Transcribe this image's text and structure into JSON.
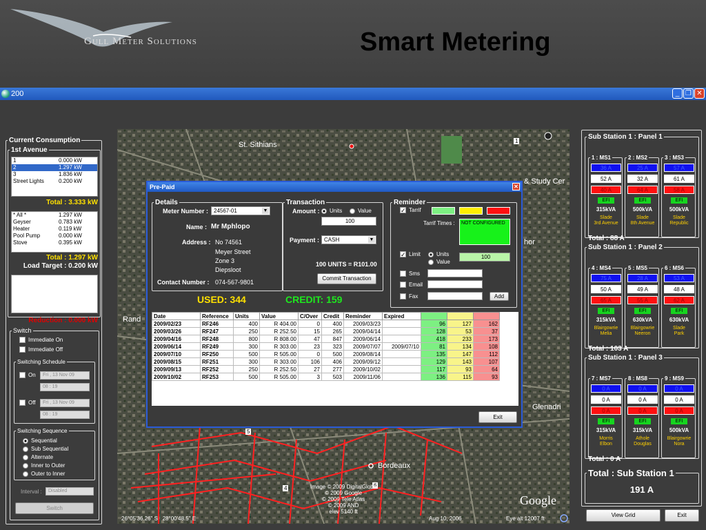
{
  "header": {
    "company": "Gull Meter Solutions",
    "slide_title": "Smart Metering"
  },
  "window": {
    "title": "200",
    "min": "_",
    "max": "❐",
    "close": "✕"
  },
  "left": {
    "current_consumption": "Current Consumption",
    "avenue": "1st Avenue",
    "avenue_rows": [
      {
        "n": "1",
        "v": "0.000 kW"
      },
      {
        "n": "2",
        "v": "1.297 kW"
      },
      {
        "n": "3",
        "v": "1.836 kW"
      },
      {
        "n": "Street Lights",
        "v": "0.200 kW"
      }
    ],
    "total_avenue": "Total : 3.333 kW",
    "unit_rows": [
      {
        "n": "* All *",
        "v": "1.297 kW"
      },
      {
        "n": "Geyser",
        "v": "0.783 kW"
      },
      {
        "n": "Heater",
        "v": "0.119 kW"
      },
      {
        "n": "Pool Pump",
        "v": "0.000 kW"
      },
      {
        "n": "Stove",
        "v": "0.395 kW"
      }
    ],
    "total_unit": "Total : 1.297 kW",
    "load_target": "Load Target : 0.200 kW",
    "reduction": "Reduction : 0.000 kW",
    "switch": "Switch",
    "immediate_on": "Immediate On",
    "immediate_off": "Immediate Off",
    "schedule": "Switching Schedule",
    "on": "On",
    "off": "Off",
    "on_date": "Fri , 13 Nov 09",
    "on_time": "08 : 19",
    "off_date": "Fri , 13 Nov 09",
    "off_time": "08 : 19",
    "sequence": "Switching Sequence",
    "seq_options": [
      "Sequential",
      "Sub Sequential",
      "Alternate",
      "Inner to Outer",
      "Outer to Inner"
    ],
    "interval": "Interval :",
    "interval_value": "Disabled",
    "switch_btn": "Switch"
  },
  "map": {
    "labels": {
      "st_sithians": "St. Sithians",
      "study": "& Study Cer",
      "hor": "hor",
      "rand": "Rand",
      "glenadri": "Glenadri",
      "bordeaux": "Bordeaux",
      "n5": "5",
      "n4": "4",
      "n6": "6",
      "n1": "1",
      "google": "Google"
    },
    "credits": "Image © 2009 DigitalGlobe\n© 2009 Google\n© 2009 Tele Atlas\n© 2009 AND\nelev 5140 ft",
    "coords": "26°05'36.26\" S   28°00'48.5\" E",
    "date": "Aug 10, 2006",
    "eye": "Eye alt 12007 ft"
  },
  "dialog": {
    "title": "Pre-Paid",
    "close": "✕",
    "details": "Details",
    "meter_label": "Meter Number :",
    "meter": "24567-01",
    "name_label": "Name :",
    "name": "Mr Mphlopo",
    "address_label": "Address :",
    "address": [
      "No 74561",
      "Meyer Street",
      "Zone 3",
      "Diepsloot"
    ],
    "contact_label": "Contact Number :",
    "contact": "074-567-9801",
    "transaction": "Transaction",
    "amount_label": "Amount :",
    "units": "Units",
    "value": "Value",
    "amount": "100",
    "payment_label": "Payment :",
    "payment": "CASH",
    "units_result": "100 UNITS  =  R101.00",
    "commit": "Commit Transaction",
    "reminder": "Reminder",
    "tarrif": "Tarrif",
    "tarrif_times": "Tarrif Times :",
    "not_configured": "NOT CONFIGURED",
    "limit": "Limit",
    "limit_units": "Units",
    "limit_value": "Value",
    "limit_amount": "100",
    "sms": "Sms",
    "email": "Email",
    "fax": "Fax",
    "add": "Add",
    "used": "USED: 344",
    "credit": "CREDIT: 159",
    "exit": "Exit",
    "columns": [
      "Date",
      "Reference",
      "Units",
      "Value",
      "C/Over",
      "Credit",
      "Reminder",
      "Expired",
      "",
      "",
      ""
    ],
    "rows": [
      [
        "2009/02/23",
        "RF246",
        "400",
        "R 404.00",
        "0",
        "400",
        "2009/03/23",
        "",
        "96",
        "127",
        "162"
      ],
      [
        "2009/03/26",
        "RF247",
        "250",
        "R 252.50",
        "15",
        "265",
        "2009/04/14",
        "",
        "128",
        "53",
        "37"
      ],
      [
        "2009/04/16",
        "RF248",
        "800",
        "R 808.00",
        "47",
        "847",
        "2009/06/14",
        "",
        "418",
        "233",
        "173"
      ],
      [
        "2009/06/14",
        "RF249",
        "300",
        "R 303.00",
        "23",
        "323",
        "2009/07/07",
        "2009/07/10",
        "81",
        "134",
        "108"
      ],
      [
        "2009/07/10",
        "RF250",
        "500",
        "R 505.00",
        "0",
        "500",
        "2009/08/14",
        "",
        "135",
        "147",
        "112"
      ],
      [
        "2009/08/15",
        "RF251",
        "300",
        "R 303.00",
        "106",
        "406",
        "2009/09/12",
        "",
        "129",
        "143",
        "107"
      ],
      [
        "2009/09/13",
        "RF252",
        "250",
        "R 252.50",
        "27",
        "277",
        "2009/10/02",
        "",
        "117",
        "93",
        "64"
      ],
      [
        "2009/10/02",
        "RF253",
        "500",
        "R 505.00",
        "3",
        "503",
        "2009/11/06",
        "",
        "136",
        "115",
        "93"
      ]
    ]
  },
  "right": {
    "panels": [
      {
        "title": "Sub Station 1 : Panel 1",
        "total": "Total : 88 A",
        "ms": [
          {
            "name": "1 : MS1",
            "a1": "36 A",
            "a2": "52 A",
            "a3": "40 A",
            "kva": "315kVA",
            "loc": [
              "Slade",
              "3rd Avenue"
            ]
          },
          {
            "name": "2 : MS2",
            "a1": "25 A",
            "a2": "32 A",
            "a3": "64 A",
            "kva": "500kVA",
            "loc": [
              "Slade",
              "8th Avenue"
            ]
          },
          {
            "name": "3 : MS3",
            "a1": "57 A",
            "a2": "61 A",
            "a3": "58 A",
            "kva": "500kVA",
            "loc": [
              "Slade",
              "Republic"
            ]
          }
        ]
      },
      {
        "title": "Sub Station 1 : Panel 2",
        "total": "Total : 103 A",
        "ms": [
          {
            "name": "4 : MS4",
            "a1": "75 A",
            "a2": "50 A",
            "a3": "65 A",
            "kva": "315kVA",
            "loc": [
              "Blairgowrie",
              "Melia"
            ]
          },
          {
            "name": "5 : MS5",
            "a1": "28 A",
            "a2": "49 A",
            "a3": "55 A",
            "kva": "630kVA",
            "loc": [
              "Blairgowrie",
              "Neeron"
            ]
          },
          {
            "name": "6 : MS6",
            "a1": "53 A",
            "a2": "48 A",
            "a3": "62 A",
            "kva": "630kVA",
            "loc": [
              "Slade",
              "Park"
            ]
          }
        ]
      },
      {
        "title": "Sub Station 1 : Panel 3",
        "total": "Total : 0 A",
        "ms": [
          {
            "name": "7 : MS7",
            "a1": "0 A",
            "a2": "0 A",
            "a3": "0 A",
            "kva": "315kVA",
            "loc": [
              "Morris",
              "Elbon"
            ]
          },
          {
            "name": "8 : MS8",
            "a1": "0 A",
            "a2": "0 A",
            "a3": "0 A",
            "kva": "315kVA",
            "loc": [
              "Athole",
              "Douglas"
            ]
          },
          {
            "name": "9 : MS9",
            "a1": "0 A",
            "a2": "0 A",
            "a3": "0 A",
            "kva": "500kVA",
            "loc": [
              "Blairgowrie",
              "Nora"
            ]
          }
        ]
      }
    ],
    "grand_title": "Total : Sub Station 1",
    "grand_value": "191 A",
    "view_grid": "View Grid",
    "exit": "Exit",
    "efi": "EFI"
  }
}
